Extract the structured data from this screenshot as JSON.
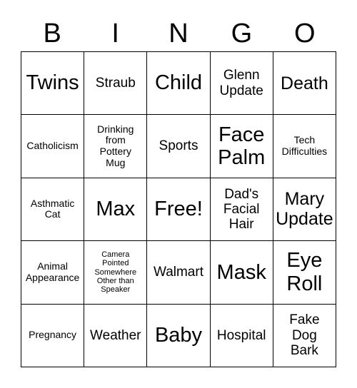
{
  "card": {
    "header_letters": [
      "B",
      "I",
      "N",
      "G",
      "O"
    ],
    "rows": [
      [
        {
          "text": "Twins",
          "size": "xl"
        },
        {
          "text": "Straub",
          "size": "md"
        },
        {
          "text": "Child",
          "size": "xl"
        },
        {
          "text": "Glenn\nUpdate",
          "size": "md"
        },
        {
          "text": "Death",
          "size": "lg"
        }
      ],
      [
        {
          "text": "Catholicism",
          "size": "sm"
        },
        {
          "text": "Drinking\nfrom\nPottery\nMug",
          "size": "sm"
        },
        {
          "text": "Sports",
          "size": "md"
        },
        {
          "text": "Face\nPalm",
          "size": "xl"
        },
        {
          "text": "Tech\nDifficulties",
          "size": "sm"
        }
      ],
      [
        {
          "text": "Asthmatic\nCat",
          "size": "sm"
        },
        {
          "text": "Max",
          "size": "xl"
        },
        {
          "text": "Free!",
          "size": "xl"
        },
        {
          "text": "Dad's\nFacial\nHair",
          "size": "md"
        },
        {
          "text": "Mary\nUpdate",
          "size": "lg"
        }
      ],
      [
        {
          "text": "Animal\nAppearance",
          "size": "sm"
        },
        {
          "text": "Camera\nPointed\nSomewhere\nOther than\nSpeaker",
          "size": "xs"
        },
        {
          "text": "Walmart",
          "size": "md"
        },
        {
          "text": "Mask",
          "size": "xl"
        },
        {
          "text": "Eye\nRoll",
          "size": "xl"
        }
      ],
      [
        {
          "text": "Pregnancy",
          "size": "sm"
        },
        {
          "text": "Weather",
          "size": "md"
        },
        {
          "text": "Baby",
          "size": "xl"
        },
        {
          "text": "Hospital",
          "size": "md"
        },
        {
          "text": "Fake\nDog\nBark",
          "size": "md"
        }
      ]
    ]
  },
  "colors": {
    "background": "#ffffff",
    "text": "#000000",
    "border": "#000000"
  }
}
